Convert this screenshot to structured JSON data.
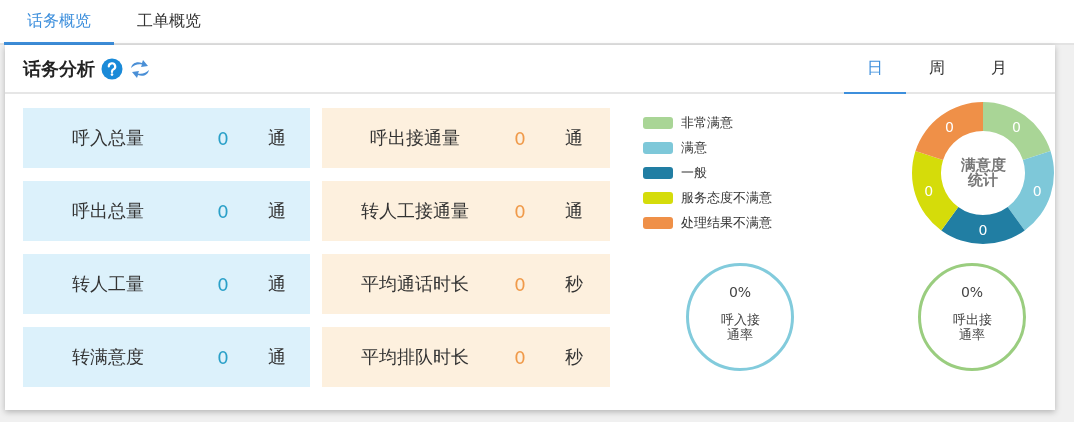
{
  "tabs": [
    {
      "label": "话务概览",
      "selected": true
    },
    {
      "label": "工单概览",
      "selected": false
    }
  ],
  "panel": {
    "title": "话务分析",
    "periods": [
      {
        "label": "日",
        "selected": true
      },
      {
        "label": "周",
        "selected": false
      },
      {
        "label": "月",
        "selected": false
      }
    ]
  },
  "stats": [
    {
      "label": "呼入总量",
      "value": "0",
      "unit": "通",
      "kind": "inbound"
    },
    {
      "label": "呼出接通量",
      "value": "0",
      "unit": "通",
      "kind": "outbound"
    },
    {
      "label": "呼出总量",
      "value": "0",
      "unit": "通",
      "kind": "inbound"
    },
    {
      "label": "转人工接通量",
      "value": "0",
      "unit": "通",
      "kind": "outbound"
    },
    {
      "label": "转人工量",
      "value": "0",
      "unit": "通",
      "kind": "inbound"
    },
    {
      "label": "平均通话时长",
      "value": "0",
      "unit": "秒",
      "kind": "outbound"
    },
    {
      "label": "转满意度",
      "value": "0",
      "unit": "通",
      "kind": "inbound"
    },
    {
      "label": "平均排队时长",
      "value": "0",
      "unit": "秒",
      "kind": "outbound"
    }
  ],
  "legend": [
    {
      "label": "非常满意",
      "color": "#a9d596"
    },
    {
      "label": "满意",
      "color": "#7ec8d9"
    },
    {
      "label": "一般",
      "color": "#217ea3"
    },
    {
      "label": "服务态度不满意",
      "color": "#d5dc0a"
    },
    {
      "label": "处理结果不满意",
      "color": "#ef9048"
    }
  ],
  "donut": {
    "center": "满意度统计",
    "segments": [
      {
        "label": "0",
        "color": "#a9d596"
      },
      {
        "label": "0",
        "color": "#7ec8d9"
      },
      {
        "label": "0",
        "color": "#217ea3"
      },
      {
        "label": "0",
        "color": "#d5dc0a"
      },
      {
        "label": "0",
        "color": "#ef9048"
      }
    ]
  },
  "rates": [
    {
      "value": "0%",
      "label": "呼入接通率",
      "color": "#82cbdc"
    },
    {
      "value": "0%",
      "label": "呼出接通率",
      "color": "#9acd7f"
    }
  ]
}
